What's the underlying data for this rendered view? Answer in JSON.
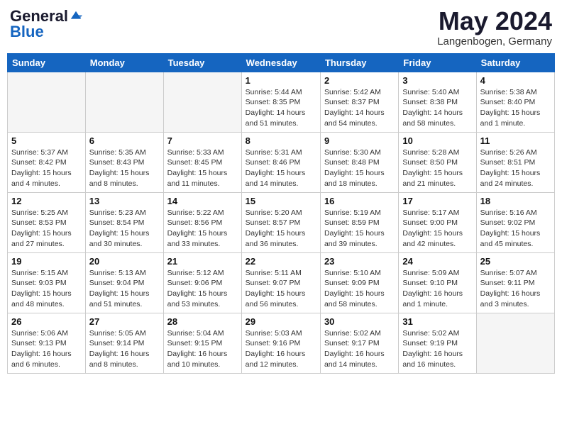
{
  "header": {
    "logo_general": "General",
    "logo_blue": "Blue",
    "month_title": "May 2024",
    "location": "Langenbogen, Germany"
  },
  "calendar": {
    "columns": [
      "Sunday",
      "Monday",
      "Tuesday",
      "Wednesday",
      "Thursday",
      "Friday",
      "Saturday"
    ],
    "weeks": [
      [
        {
          "day": "",
          "content": ""
        },
        {
          "day": "",
          "content": ""
        },
        {
          "day": "",
          "content": ""
        },
        {
          "day": "1",
          "content": "Sunrise: 5:44 AM\nSunset: 8:35 PM\nDaylight: 14 hours\nand 51 minutes."
        },
        {
          "day": "2",
          "content": "Sunrise: 5:42 AM\nSunset: 8:37 PM\nDaylight: 14 hours\nand 54 minutes."
        },
        {
          "day": "3",
          "content": "Sunrise: 5:40 AM\nSunset: 8:38 PM\nDaylight: 14 hours\nand 58 minutes."
        },
        {
          "day": "4",
          "content": "Sunrise: 5:38 AM\nSunset: 8:40 PM\nDaylight: 15 hours\nand 1 minute."
        }
      ],
      [
        {
          "day": "5",
          "content": "Sunrise: 5:37 AM\nSunset: 8:42 PM\nDaylight: 15 hours\nand 4 minutes."
        },
        {
          "day": "6",
          "content": "Sunrise: 5:35 AM\nSunset: 8:43 PM\nDaylight: 15 hours\nand 8 minutes."
        },
        {
          "day": "7",
          "content": "Sunrise: 5:33 AM\nSunset: 8:45 PM\nDaylight: 15 hours\nand 11 minutes."
        },
        {
          "day": "8",
          "content": "Sunrise: 5:31 AM\nSunset: 8:46 PM\nDaylight: 15 hours\nand 14 minutes."
        },
        {
          "day": "9",
          "content": "Sunrise: 5:30 AM\nSunset: 8:48 PM\nDaylight: 15 hours\nand 18 minutes."
        },
        {
          "day": "10",
          "content": "Sunrise: 5:28 AM\nSunset: 8:50 PM\nDaylight: 15 hours\nand 21 minutes."
        },
        {
          "day": "11",
          "content": "Sunrise: 5:26 AM\nSunset: 8:51 PM\nDaylight: 15 hours\nand 24 minutes."
        }
      ],
      [
        {
          "day": "12",
          "content": "Sunrise: 5:25 AM\nSunset: 8:53 PM\nDaylight: 15 hours\nand 27 minutes."
        },
        {
          "day": "13",
          "content": "Sunrise: 5:23 AM\nSunset: 8:54 PM\nDaylight: 15 hours\nand 30 minutes."
        },
        {
          "day": "14",
          "content": "Sunrise: 5:22 AM\nSunset: 8:56 PM\nDaylight: 15 hours\nand 33 minutes."
        },
        {
          "day": "15",
          "content": "Sunrise: 5:20 AM\nSunset: 8:57 PM\nDaylight: 15 hours\nand 36 minutes."
        },
        {
          "day": "16",
          "content": "Sunrise: 5:19 AM\nSunset: 8:59 PM\nDaylight: 15 hours\nand 39 minutes."
        },
        {
          "day": "17",
          "content": "Sunrise: 5:17 AM\nSunset: 9:00 PM\nDaylight: 15 hours\nand 42 minutes."
        },
        {
          "day": "18",
          "content": "Sunrise: 5:16 AM\nSunset: 9:02 PM\nDaylight: 15 hours\nand 45 minutes."
        }
      ],
      [
        {
          "day": "19",
          "content": "Sunrise: 5:15 AM\nSunset: 9:03 PM\nDaylight: 15 hours\nand 48 minutes."
        },
        {
          "day": "20",
          "content": "Sunrise: 5:13 AM\nSunset: 9:04 PM\nDaylight: 15 hours\nand 51 minutes."
        },
        {
          "day": "21",
          "content": "Sunrise: 5:12 AM\nSunset: 9:06 PM\nDaylight: 15 hours\nand 53 minutes."
        },
        {
          "day": "22",
          "content": "Sunrise: 5:11 AM\nSunset: 9:07 PM\nDaylight: 15 hours\nand 56 minutes."
        },
        {
          "day": "23",
          "content": "Sunrise: 5:10 AM\nSunset: 9:09 PM\nDaylight: 15 hours\nand 58 minutes."
        },
        {
          "day": "24",
          "content": "Sunrise: 5:09 AM\nSunset: 9:10 PM\nDaylight: 16 hours\nand 1 minute."
        },
        {
          "day": "25",
          "content": "Sunrise: 5:07 AM\nSunset: 9:11 PM\nDaylight: 16 hours\nand 3 minutes."
        }
      ],
      [
        {
          "day": "26",
          "content": "Sunrise: 5:06 AM\nSunset: 9:13 PM\nDaylight: 16 hours\nand 6 minutes."
        },
        {
          "day": "27",
          "content": "Sunrise: 5:05 AM\nSunset: 9:14 PM\nDaylight: 16 hours\nand 8 minutes."
        },
        {
          "day": "28",
          "content": "Sunrise: 5:04 AM\nSunset: 9:15 PM\nDaylight: 16 hours\nand 10 minutes."
        },
        {
          "day": "29",
          "content": "Sunrise: 5:03 AM\nSunset: 9:16 PM\nDaylight: 16 hours\nand 12 minutes."
        },
        {
          "day": "30",
          "content": "Sunrise: 5:02 AM\nSunset: 9:17 PM\nDaylight: 16 hours\nand 14 minutes."
        },
        {
          "day": "31",
          "content": "Sunrise: 5:02 AM\nSunset: 9:19 PM\nDaylight: 16 hours\nand 16 minutes."
        },
        {
          "day": "",
          "content": ""
        }
      ]
    ]
  }
}
